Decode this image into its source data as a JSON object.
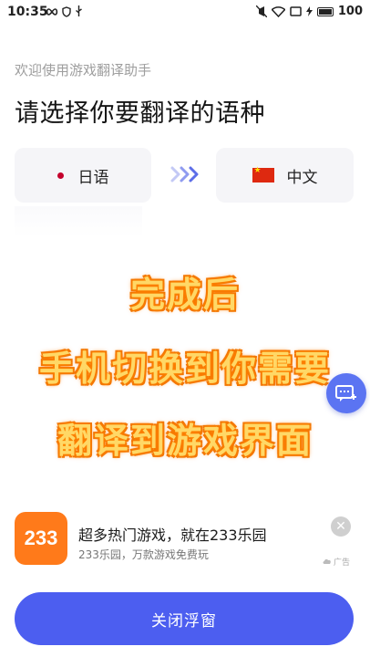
{
  "status_bar": {
    "time": "10:35",
    "battery": "100",
    "icons": [
      "infinity-icon",
      "shield-icon",
      "usb-icon",
      "mute-icon",
      "wifi-icon",
      "screen-icon",
      "charging-icon",
      "battery-icon"
    ]
  },
  "header": {
    "welcome": "欢迎使用游戏翻译助手",
    "title": "请选择你要翻译的语种"
  },
  "languages": {
    "source": "日语",
    "target": "中文"
  },
  "overlay": {
    "lines": [
      "完成后",
      "手机切换到你需要",
      "翻译到游戏界面"
    ]
  },
  "ad": {
    "logo_text": "233",
    "title": "超多热门游戏，就在233乐园",
    "subtitle": "233乐园，万款游戏免费玩",
    "tag": "广告"
  },
  "footer": {
    "close_label": "关闭浮窗"
  },
  "colors": {
    "accent": "#4c5ef0",
    "float_button": "#5b74f2",
    "ad_logo": "#ff7a1a",
    "overlay_text": "#ffd866"
  }
}
